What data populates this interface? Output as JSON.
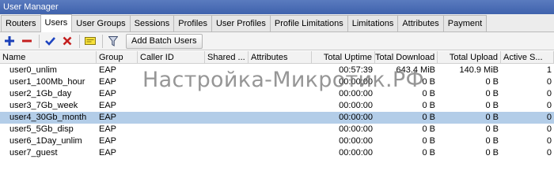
{
  "window": {
    "title": "User Manager"
  },
  "tabs": [
    {
      "label": "Routers",
      "active": false
    },
    {
      "label": "Users",
      "active": true
    },
    {
      "label": "User Groups",
      "active": false
    },
    {
      "label": "Sessions",
      "active": false
    },
    {
      "label": "Profiles",
      "active": false
    },
    {
      "label": "User Profiles",
      "active": false
    },
    {
      "label": "Profile Limitations",
      "active": false
    },
    {
      "label": "Limitations",
      "active": false
    },
    {
      "label": "Attributes",
      "active": false
    },
    {
      "label": "Payment",
      "active": false
    }
  ],
  "toolbar": {
    "icons": [
      "add-icon",
      "remove-icon",
      "enable-check-icon",
      "disable-x-icon",
      "comment-note-icon",
      "filter-icon"
    ],
    "add_batch_label": "Add Batch Users"
  },
  "table": {
    "columns": [
      "Name",
      "Group",
      "Caller ID",
      "Shared ...",
      "Attributes",
      "Total Uptime",
      "Total Download",
      "Total Upload",
      "Active S..."
    ],
    "rows": [
      {
        "name": "user0_unlim",
        "group": "EAP",
        "caller_id": "",
        "shared": "",
        "attributes": "",
        "uptime": "00:57:39",
        "download": "643.4 MiB",
        "upload": "140.9 MiB",
        "active": "1",
        "selected": false
      },
      {
        "name": "user1_100Mb_hour",
        "group": "EAP",
        "caller_id": "",
        "shared": "",
        "attributes": "",
        "uptime": "00:00:00",
        "download": "0 B",
        "upload": "0 B",
        "active": "0",
        "selected": false
      },
      {
        "name": "user2_1Gb_day",
        "group": "EAP",
        "caller_id": "",
        "shared": "",
        "attributes": "",
        "uptime": "00:00:00",
        "download": "0 B",
        "upload": "0 B",
        "active": "0",
        "selected": false
      },
      {
        "name": "user3_7Gb_week",
        "group": "EAP",
        "caller_id": "",
        "shared": "",
        "attributes": "",
        "uptime": "00:00:00",
        "download": "0 B",
        "upload": "0 B",
        "active": "0",
        "selected": false
      },
      {
        "name": "user4_30Gb_month",
        "group": "EAP",
        "caller_id": "",
        "shared": "",
        "attributes": "",
        "uptime": "00:00:00",
        "download": "0 B",
        "upload": "0 B",
        "active": "0",
        "selected": true
      },
      {
        "name": "user5_5Gb_disp",
        "group": "EAP",
        "caller_id": "",
        "shared": "",
        "attributes": "",
        "uptime": "00:00:00",
        "download": "0 B",
        "upload": "0 B",
        "active": "0",
        "selected": false
      },
      {
        "name": "user6_1Day_unlim",
        "group": "EAP",
        "caller_id": "",
        "shared": "",
        "attributes": "",
        "uptime": "00:00:00",
        "download": "0 B",
        "upload": "0 B",
        "active": "0",
        "selected": false
      },
      {
        "name": "user7_guest",
        "group": "EAP",
        "caller_id": "",
        "shared": "",
        "attributes": "",
        "uptime": "00:00:00",
        "download": "0 B",
        "upload": "0 B",
        "active": "0",
        "selected": false
      }
    ]
  },
  "watermark": "Настройка-Микротик.РФ",
  "colors": {
    "selection": "#b3cde8",
    "titlebar": "#4a6cb3"
  }
}
